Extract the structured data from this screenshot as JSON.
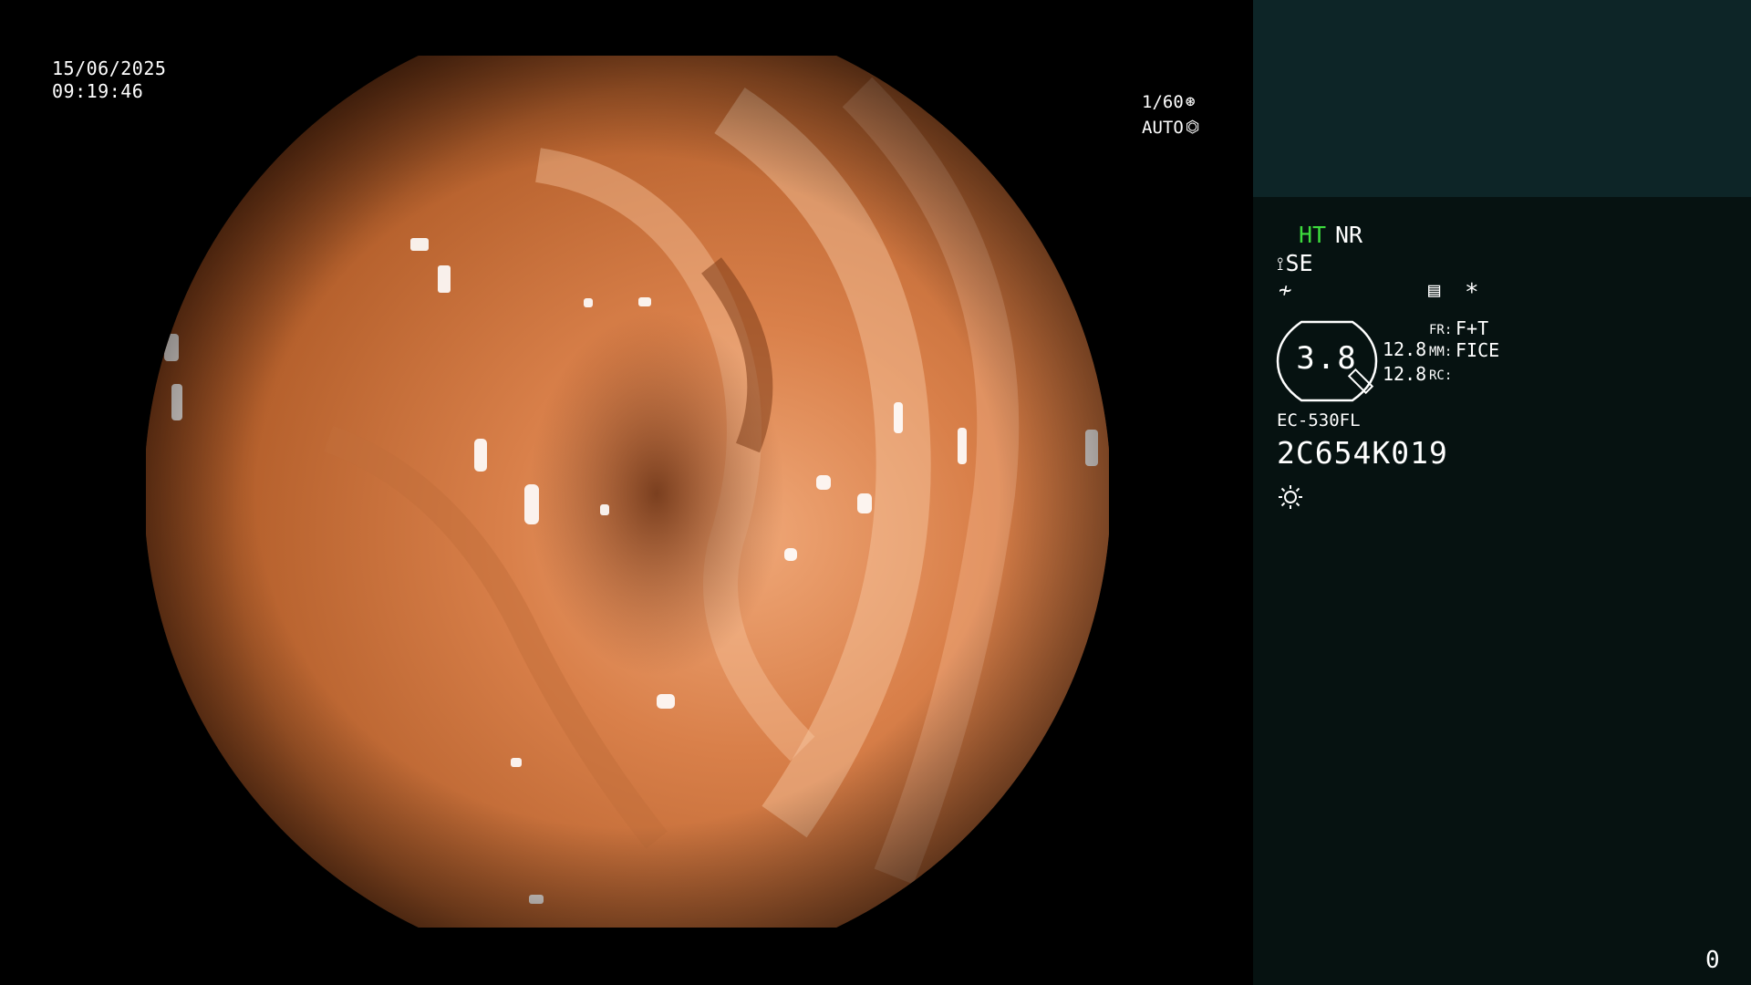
{
  "overlay": {
    "date": "15/06/2025",
    "time": "09:19:46",
    "shutter_speed": "1/60",
    "shutter_icon": "aperture-icon",
    "exposure_mode": "AUTO",
    "exposure_icon": "iris-icon"
  },
  "panel": {
    "ht_label": "HT",
    "nr_label": "NR",
    "se_label": "SE",
    "se_icon": "scope-icon",
    "flash_icon_name": "flash-off-icon",
    "list_icon_name": "settings-list-icon",
    "star_symbol": "*",
    "zoom_value": "3.8",
    "value_1": "12.8",
    "value_2": "12.8",
    "fr_label": "FR:",
    "fr_value": "F+T",
    "mm_label": "MM:",
    "mm_value": "FICE",
    "rc_label": "RC:",
    "model": "EC-530FL",
    "serial": "2C654K019",
    "light_icon_name": "light-source-icon",
    "counter": "0"
  },
  "colors": {
    "ht_green": "#3ddc3d",
    "panel_top": "#0d2527",
    "panel_bottom": "#061211",
    "background": "#000000"
  }
}
